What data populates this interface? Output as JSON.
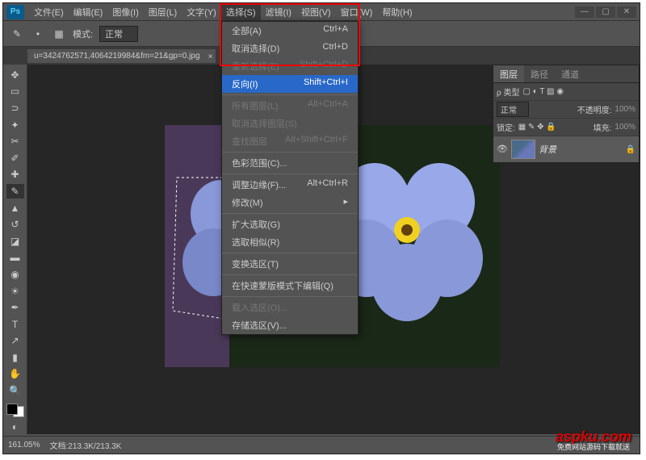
{
  "menubar": {
    "items": [
      "文件(E)",
      "编辑(E)",
      "图像(I)",
      "图层(L)",
      "文字(Y)",
      "选择(S)",
      "滤镜(I)",
      "视图(V)",
      "窗口(W)",
      "帮助(H)"
    ],
    "active_index": 5
  },
  "toolbar": {
    "mode_label": "模式:",
    "mode_value": "正常"
  },
  "tab": {
    "title": "u=3424762571,4064219984&fm=21&gp=0.jpg",
    "close": "×"
  },
  "dropdown": {
    "items": [
      {
        "label": "全部(A)",
        "shortcut": "Ctrl+A",
        "disabled": false
      },
      {
        "label": "取消选择(D)",
        "shortcut": "Ctrl+D",
        "disabled": false
      },
      {
        "label": "重新选择(E)",
        "shortcut": "Shift+Ctrl+D",
        "disabled": true
      },
      {
        "label": "反向(I)",
        "shortcut": "Shift+Ctrl+I",
        "disabled": false,
        "highlighted": true
      },
      {
        "sep": true
      },
      {
        "label": "所有图层(L)",
        "shortcut": "Alt+Ctrl+A",
        "disabled": true
      },
      {
        "label": "取消选择图层(S)",
        "shortcut": "",
        "disabled": true
      },
      {
        "label": "查找图层",
        "shortcut": "Alt+Shift+Ctrl+F",
        "disabled": true
      },
      {
        "sep": true
      },
      {
        "label": "色彩范围(C)...",
        "shortcut": "",
        "disabled": false
      },
      {
        "sep": true
      },
      {
        "label": "调整边缘(F)...",
        "shortcut": "Alt+Ctrl+R",
        "disabled": false
      },
      {
        "label": "修改(M)",
        "shortcut": "▸",
        "disabled": false
      },
      {
        "sep": true
      },
      {
        "label": "扩大选取(G)",
        "shortcut": "",
        "disabled": false
      },
      {
        "label": "选取相似(R)",
        "shortcut": "",
        "disabled": false
      },
      {
        "sep": true
      },
      {
        "label": "变换选区(T)",
        "shortcut": "",
        "disabled": false
      },
      {
        "sep": true
      },
      {
        "label": "在快速蒙版模式下编辑(Q)",
        "shortcut": "",
        "disabled": false
      },
      {
        "sep": true
      },
      {
        "label": "载入选区(O)...",
        "shortcut": "",
        "disabled": true
      },
      {
        "label": "存储选区(V)...",
        "shortcut": "",
        "disabled": false
      }
    ]
  },
  "layers_panel": {
    "tabs": [
      "图层",
      "路径",
      "通道"
    ],
    "kind_label": "ρ 类型",
    "blend_mode": "正常",
    "opacity_label": "不透明度:",
    "opacity_value": "100%",
    "lock_label": "锁定:",
    "fill_label": "填充:",
    "fill_value": "100%",
    "layer_name": "背景"
  },
  "status": {
    "zoom": "161.05%",
    "doc": "文档:213.3K/213.3K"
  },
  "watermark": {
    "main": "aspku.com",
    "sub": "免费网站源码下载就送"
  }
}
